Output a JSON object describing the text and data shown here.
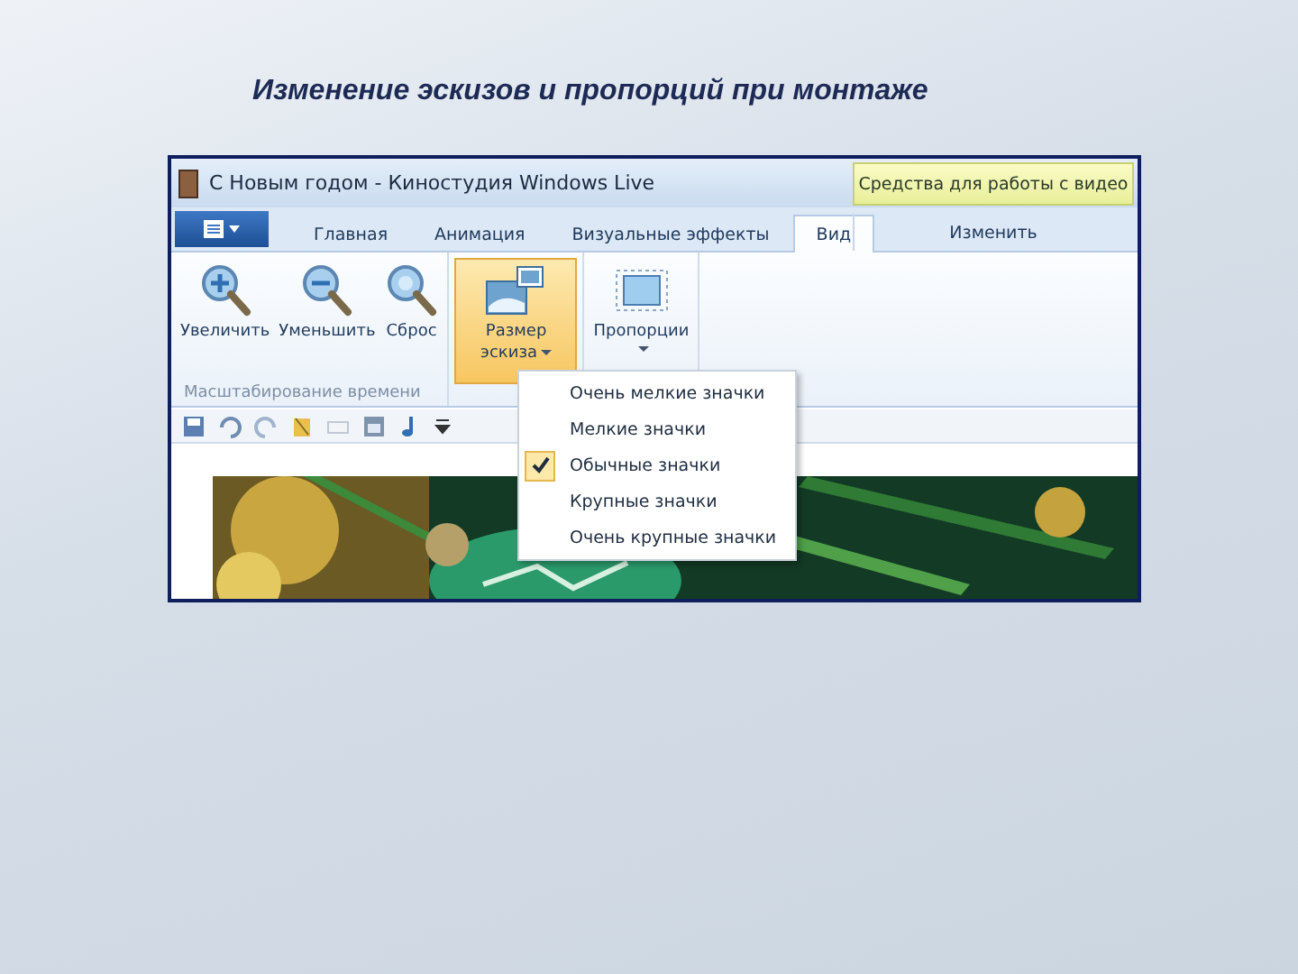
{
  "slide": {
    "title": "Изменение эскизов и пропорций при монтаже"
  },
  "window": {
    "title": "С Новым годом - Киностудия Windows Live",
    "contextual_group": "Средства для работы с видео"
  },
  "tabs": [
    {
      "label": "Главная",
      "selected": false
    },
    {
      "label": "Анимация",
      "selected": false
    },
    {
      "label": "Визуальные эффекты",
      "selected": false
    },
    {
      "label": "Вид",
      "selected": true
    },
    {
      "label": "Изменить",
      "selected": false
    }
  ],
  "ribbon": {
    "groups": [
      {
        "label": "Масштабирование времени",
        "buttons": [
          {
            "label": "Увеличить",
            "dropdown": false,
            "pressed": false
          },
          {
            "label": "Уменьшить",
            "dropdown": false,
            "pressed": false
          },
          {
            "label": "Сброс",
            "dropdown": false,
            "pressed": false
          }
        ]
      },
      {
        "buttons": [
          {
            "label": "Размер эскиза",
            "dropdown": true,
            "pressed": true
          }
        ]
      },
      {
        "buttons": [
          {
            "label": "Пропорции",
            "dropdown": true,
            "pressed": false
          }
        ]
      }
    ]
  },
  "menu": {
    "items": [
      {
        "label": "Очень мелкие значки",
        "checked": false
      },
      {
        "label": "Мелкие значки",
        "checked": false
      },
      {
        "label": "Обычные значки",
        "checked": true
      },
      {
        "label": "Крупные значки",
        "checked": false
      },
      {
        "label": "Очень крупные значки",
        "checked": false
      }
    ]
  }
}
